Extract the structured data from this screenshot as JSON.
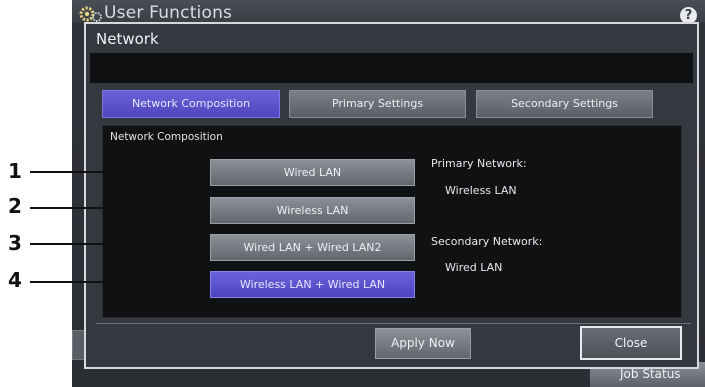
{
  "window": {
    "title": "User Functions"
  },
  "icons": {
    "gear": "gear-icon",
    "help": "help-icon",
    "help_glyph": "?"
  },
  "dialog": {
    "title": "Network",
    "message": "",
    "tabs": [
      {
        "label": "Network Composition",
        "active": true
      },
      {
        "label": "Primary Settings",
        "active": false
      },
      {
        "label": "Secondary Settings",
        "active": false
      }
    ],
    "section_label": "Network Composition",
    "options": [
      {
        "label": "Wired LAN",
        "selected": false
      },
      {
        "label": "Wireless LAN",
        "selected": false
      },
      {
        "label": "Wired LAN + Wired LAN2",
        "selected": false
      },
      {
        "label": "Wireless LAN + Wired LAN",
        "selected": true
      }
    ],
    "primary_network": {
      "label": "Primary Network:",
      "value": "Wireless LAN"
    },
    "secondary_network": {
      "label": "Secondary Network:",
      "value": "Wired LAN"
    },
    "apply_label": "Apply Now",
    "close_label": "Close"
  },
  "job_status": "Job Status",
  "callouts": [
    "1",
    "2",
    "3",
    "4"
  ],
  "colors": {
    "accent": "#5a52cc",
    "panel": "#35383e",
    "content_bg": "#101113"
  }
}
